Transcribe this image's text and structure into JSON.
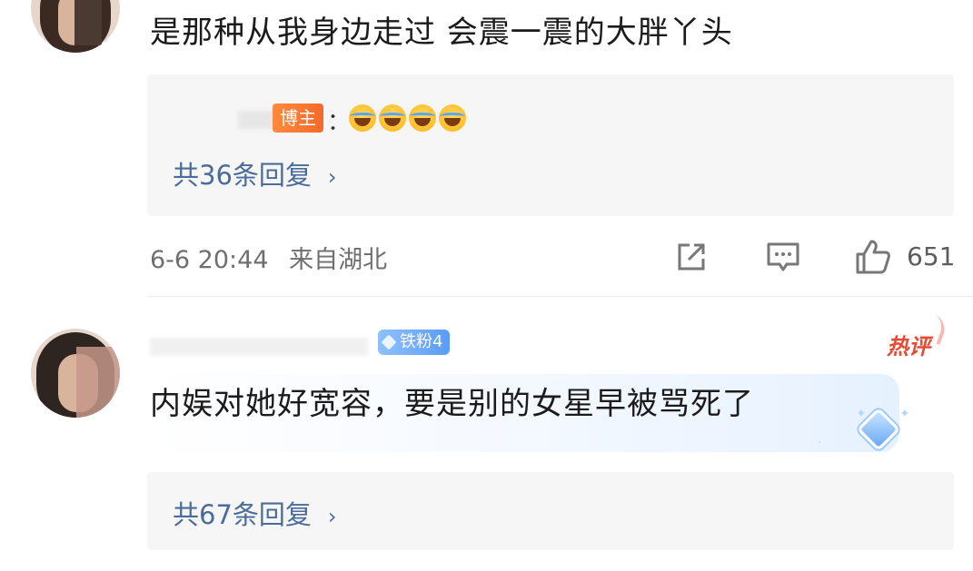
{
  "comments": [
    {
      "text": "是那种从我身边走过 会震一震的大胖丫头",
      "reply": {
        "author_badge": "博主",
        "separator": "：",
        "emoji_icons": [
          "laugh-cry-emoji",
          "laugh-cry-emoji",
          "laugh-cry-emoji",
          "laugh-cry-emoji"
        ]
      },
      "reply_count_label": "共36条回复",
      "reply_chevron": "›",
      "timestamp": "6-6 20:44",
      "location": "来自湖北",
      "like_count": "651"
    },
    {
      "fan_badge": "铁粉4",
      "hot_badge": "热评",
      "text": "内娱对她好宽容，要是别的女星早被骂死了",
      "reply_count_label": "共67条回复",
      "reply_chevron": "›"
    }
  ],
  "icons": {
    "share": "share-icon",
    "comment": "comment-icon",
    "like": "thumbs-up-icon"
  },
  "colors": {
    "link_blue": "#4a6c9a",
    "author_badge": "#f46a2b",
    "fan_badge": "#5a9cf8",
    "hot_red": "#e64a34",
    "reply_bg": "#f6f6f7"
  }
}
